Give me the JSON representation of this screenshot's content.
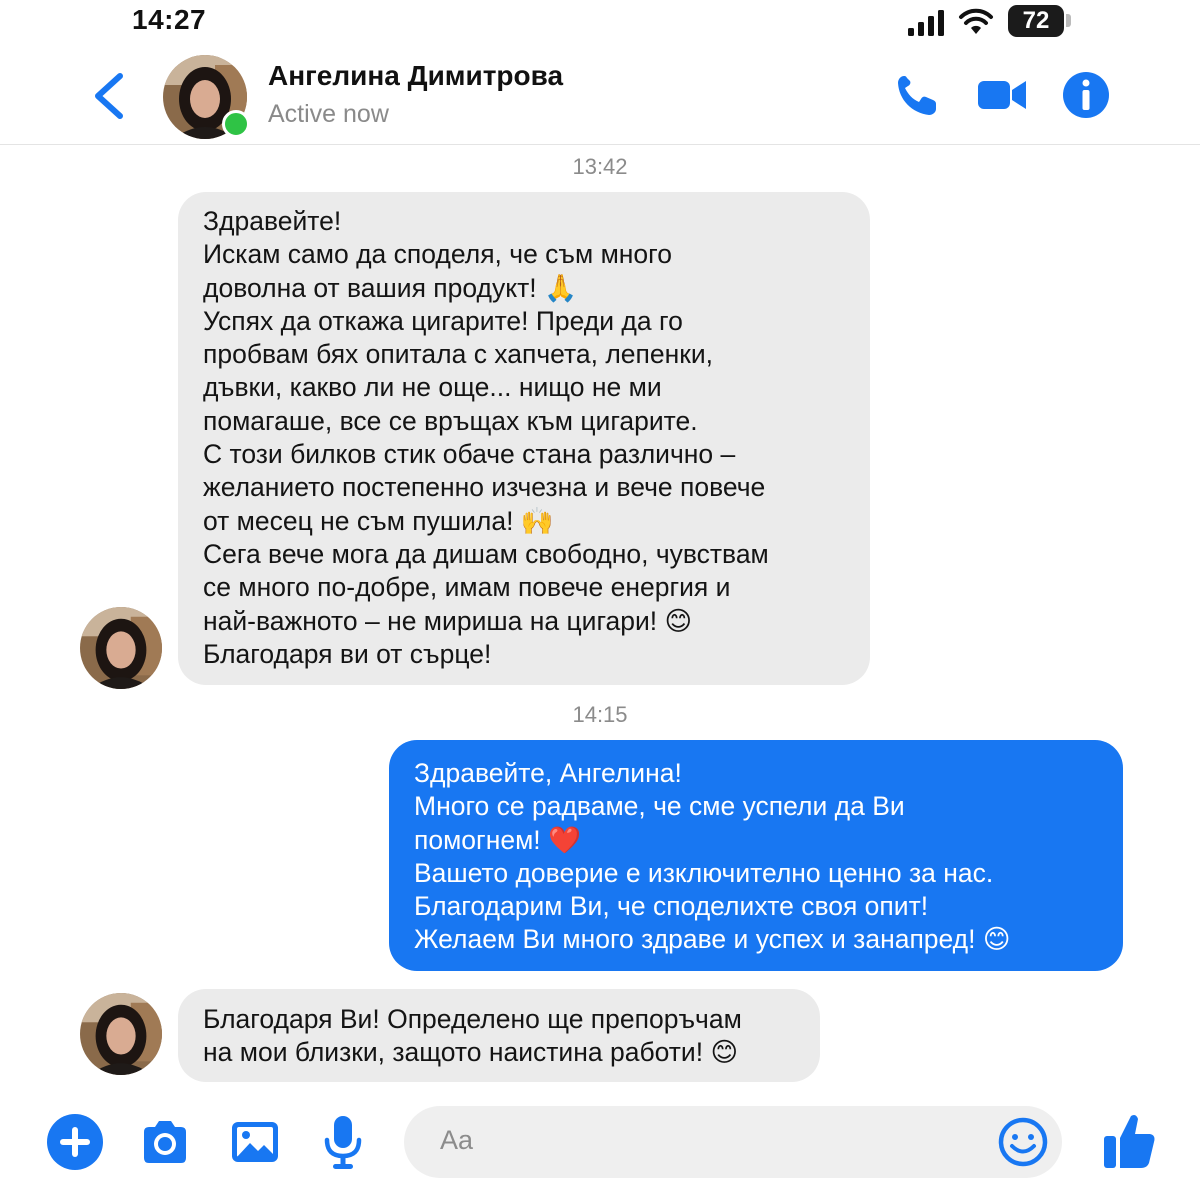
{
  "status_bar": {
    "time": "14:27",
    "battery": "72"
  },
  "header": {
    "name": "Ангелина Димитрова",
    "status": "Active now"
  },
  "timestamps": [
    "13:42",
    "14:15"
  ],
  "messages": [
    {
      "from": "contact",
      "lines": [
        "Здравейте!",
        "Искам само да споделя, че съм много",
        "доволна от вашия продукт! 🙏",
        "Успях да откажа цигарите! Преди да го",
        "пробвам бях опитала с хапчета, лепенки,",
        "дъвки, какво ли не още... нищо не ми",
        "помагаше, все се връщах към цигарите.",
        "С този билков стик обаче стана различно –",
        "желанието постепенно изчезна и вече повече",
        "от месец не съм пушила! 🙌",
        "Сега вече мога да дишам свободно, чувствам",
        "се много по-добре, имам повече енергия и",
        "най-важното – не мириша на цигари! 😊",
        "Благодаря ви от сърце!"
      ]
    },
    {
      "from": "me",
      "lines": [
        "Здравейте, Ангелина!",
        "Много се радваме, че сме успели да Ви",
        "помогнем! ❤️",
        "Вашето доверие е изключително ценно за нас.",
        "Благодарим Ви, че споделихте своя опит!",
        "Желаем Ви много здраве и успех и занапред! 😊"
      ]
    },
    {
      "from": "contact",
      "lines": [
        "Благодаря Ви! Определено ще препоръчам",
        "на мои близки, защото наистина работи! 😊"
      ]
    }
  ],
  "composer": {
    "placeholder": "Aa"
  },
  "colors": {
    "accent": "#1877f2",
    "incoming_bubble": "#ebebeb",
    "online": "#2fc345"
  },
  "icons": [
    "back-icon",
    "phone-icon",
    "video-camera-icon",
    "info-icon",
    "plus-icon",
    "camera-icon",
    "gallery-icon",
    "microphone-icon",
    "emoji-icon",
    "thumbs-up-icon"
  ]
}
